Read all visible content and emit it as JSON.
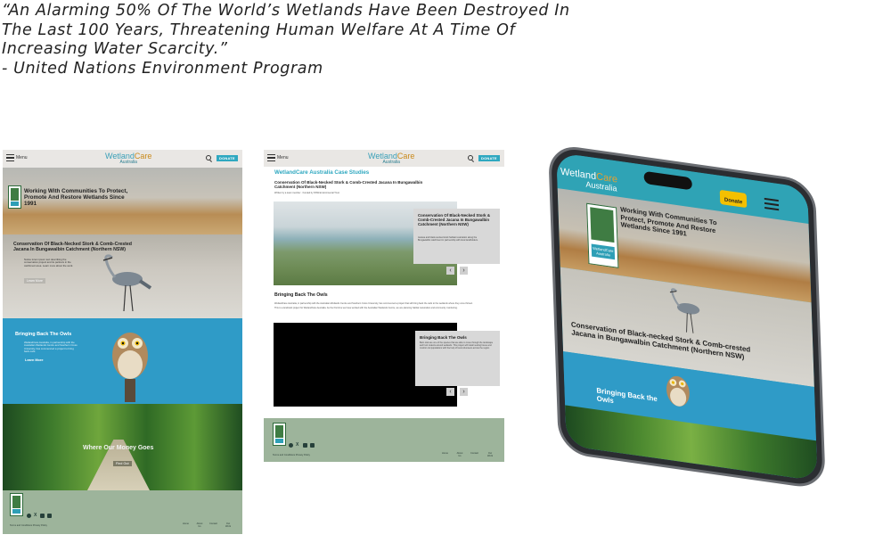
{
  "quote": {
    "lines": [
      "“An Alarming 50% Of The World’s Wetlands Have Been Destroyed In",
      "The Last 100 Years, Threatening Human Welfare At A Time Of",
      "Increasing Water Scarcity.”",
      "- United Nations Environment Program"
    ]
  },
  "brand": {
    "name_a": "Wetland",
    "name_b": "Care",
    "sub": "Australia",
    "accent": "#2fa8c0",
    "gold": "#c98a1c",
    "footer_green": "#9db49b",
    "owl_blue": "#2f9bc7"
  },
  "nav": {
    "menu_label": "Menu",
    "donate_label": "DONATE",
    "search_icon": "search-icon",
    "menu_icon": "hamburger-menu-icon"
  },
  "home": {
    "hero_title": "Working With Communities To Protect, Promote And Restore Wetlands Since 1991",
    "stork_title": "Conservation Of Black-Necked Stork & Comb-Crested Jacana In Bungawalbin Catchment (Northern NSW)",
    "stork_text": "Notice lorem ipsum text describing the conservation project and its partners in the catchment area. Learn more about the work.",
    "stork_button": "Learn More",
    "owls_title": "Bringing Back The Owls",
    "owls_text": "WetlandCare Australia, in partnership with the Australian Wetlands Centre and Southern Cross University, has commenced a project to bring back owls.",
    "owls_link": "Learn More",
    "money_title": "Where Our Money Goes",
    "money_button": "Find Out"
  },
  "case_studies": {
    "heading": "WetlandCare Australia Case Studies",
    "project_title": "Conservation Of Black-Necked Stork & Comb-Crested Jacana In Bungawalbin Catchment (Northern NSW)",
    "project_meta": "Written by a team member · Funded by NSW Environmental Trust",
    "card1_title": "Conservation Of Black-Necked Stork & Comb-Crested Jacana In Bungawalbin Catchment (Northern NSW)",
    "card1_text": "Jacana and black-necked stork habitat restoration along the Bungawalbin catchment in partnership with local landholders.",
    "owls_heading": "Bringing Back The Owls",
    "owls_para1": "WetlandCare Australia, in partnership with the Australian Wetlands Centre and Southern Cross University, has commenced a project that will bring back the owls to the wetlands where they once thrived.",
    "owls_para2": "This is a landmark project for WetlandCare Australia. As the first time we have worked with the Australian Wetlands Centre, we are planning habitat restoration and community monitoring.",
    "card2_title": "Bringing Back The Owls",
    "card2_text": "Barn owls are one of the species that are able to move through the landscape and hunt rodents around wetlands. This project will install nesting boxes and monitor owl populations with the help of local volunteers across the region.",
    "prev": "‹",
    "next": "›"
  },
  "footer": {
    "legal": "Terms and Conditions   Privacy Policy",
    "links": [
      "Home",
      "About Us",
      "Contact",
      "Our Work"
    ]
  },
  "phone": {
    "logo_a": "Wetland",
    "logo_b": "Care",
    "logo_sub": "Australia",
    "donate": "Donate",
    "hero_title": "Working With Communities To Protect, Promote And Restore Wetlands Since 1991",
    "badge_caption": "WetlandCare Australia",
    "stork_title": "Conservation of Black-necked Stork & Comb-crested Jacana in Bungawalbin Catchment (Northern NSW)",
    "owls_title": "Bringing Back the Owls"
  }
}
